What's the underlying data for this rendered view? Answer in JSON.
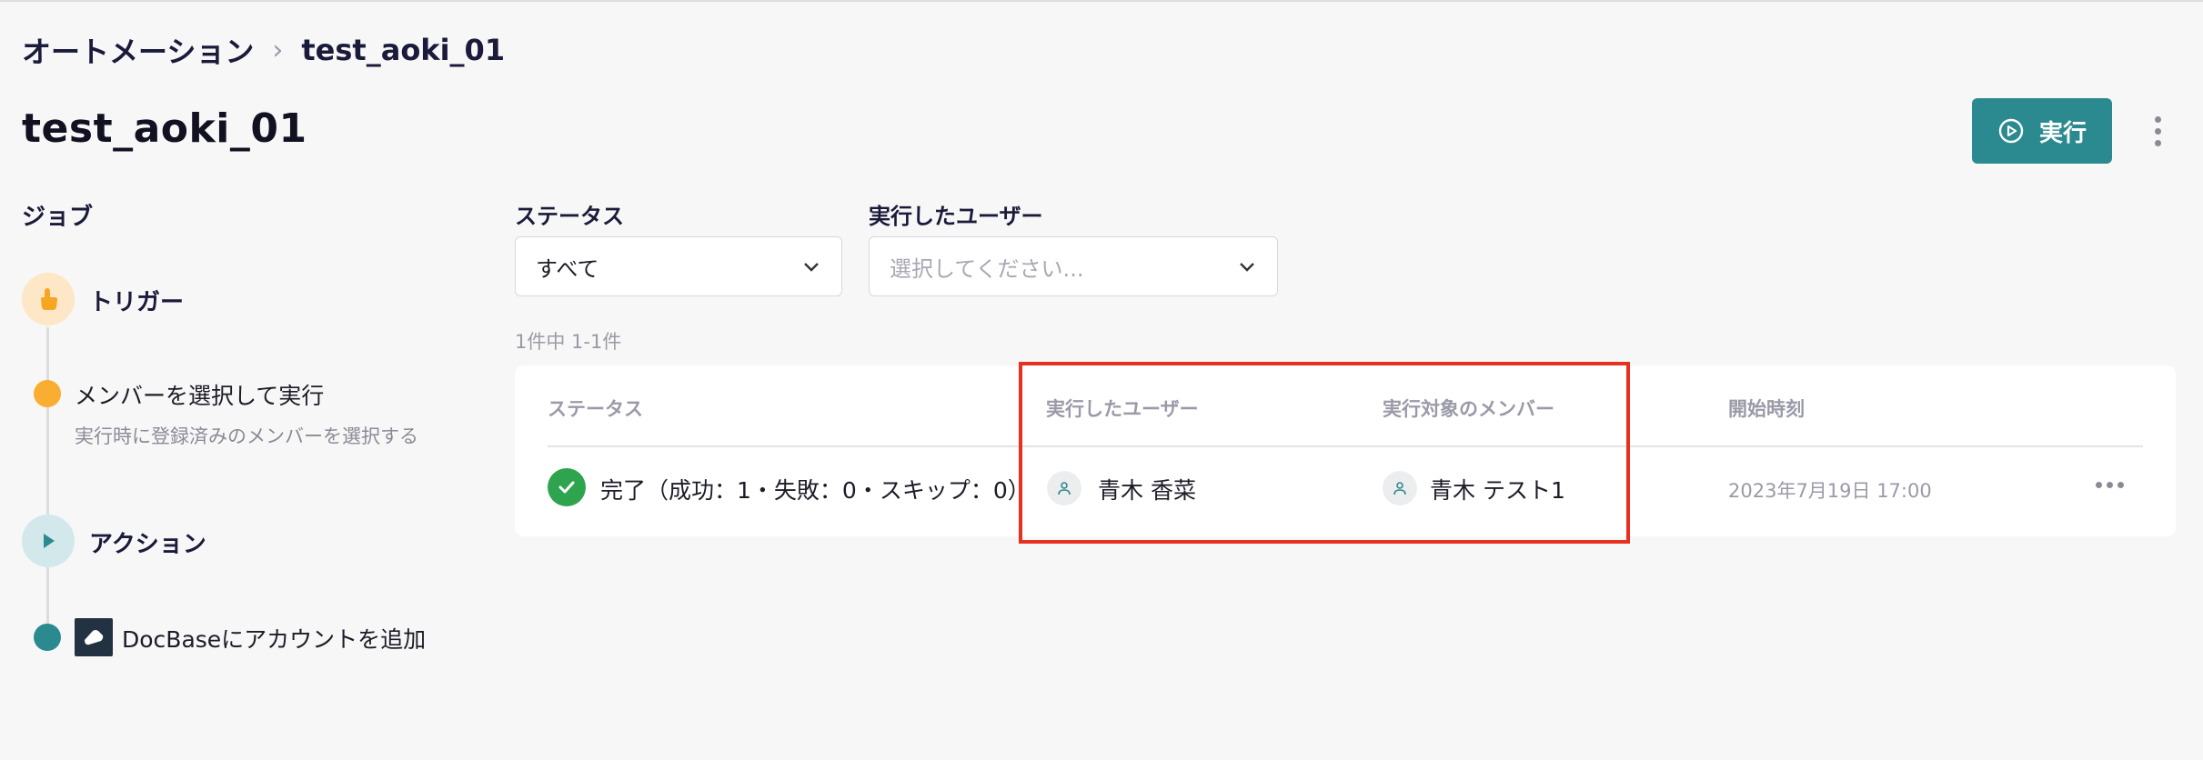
{
  "breadcrumb": {
    "parent": "オートメーション",
    "current": "test_aoki_01"
  },
  "page": {
    "title": "test_aoki_01"
  },
  "header": {
    "run_label": "実行"
  },
  "jobs": {
    "heading": "ジョブ",
    "trigger": {
      "label": "トリガー",
      "step_title": "メンバーを選択して実行",
      "step_desc": "実行時に登録済みのメンバーを選択する"
    },
    "action": {
      "label": "アクション",
      "step_title": "DocBaseにアカウントを追加"
    }
  },
  "filters": {
    "status": {
      "label": "ステータス",
      "value": "すべて"
    },
    "user": {
      "label": "実行したユーザー",
      "placeholder": "選択してください..."
    }
  },
  "results": {
    "count": "1件中 1-1件"
  },
  "table": {
    "columns": [
      "ステータス",
      "実行したユーザー",
      "実行対象のメンバー",
      "開始時刻"
    ],
    "rows": [
      {
        "status": "完了（成功：1・失敗：0・スキップ：0）",
        "executed_by": "青木 香菜",
        "target_member": "青木 テスト1",
        "started_at": "2023年7月19日 17:00"
      }
    ]
  },
  "colors": {
    "accent": "#2b8a8f",
    "success": "#2ea44f",
    "trigger": "#f9ae31",
    "highlight": "#e8301f"
  },
  "icons": [
    "chevron-right-icon",
    "play-circle-icon",
    "kebab-icon",
    "hand-pointer-icon",
    "play-icon",
    "docbase-logo-icon",
    "chevron-down-icon",
    "check-icon",
    "user-icon"
  ]
}
